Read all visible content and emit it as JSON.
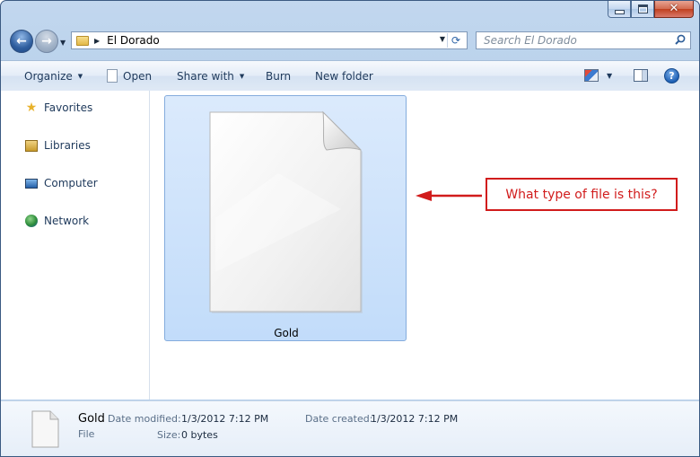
{
  "window": {
    "controls": {
      "minimize": "minimize",
      "maximize": "maximize",
      "close": "close"
    }
  },
  "address_bar": {
    "path": "El Dorado",
    "search_placeholder": "Search El Dorado"
  },
  "toolbar": {
    "organize": "Organize",
    "open": "Open",
    "share_with": "Share with",
    "burn": "Burn",
    "new_folder": "New folder",
    "help": "?"
  },
  "navigation": {
    "items": [
      {
        "label": "Favorites",
        "icon": "star-icon"
      },
      {
        "label": "Libraries",
        "icon": "libraries-icon"
      },
      {
        "label": "Computer",
        "icon": "computer-icon"
      },
      {
        "label": "Network",
        "icon": "network-icon"
      }
    ]
  },
  "files": [
    {
      "name": "Gold",
      "icon": "blank-document-icon",
      "selected": true
    }
  ],
  "annotation": {
    "text": "What type of file is this?",
    "color": "#d11c1c"
  },
  "details": {
    "name": "Gold",
    "type": "File",
    "date_modified_label": "Date modified:",
    "date_modified": "1/3/2012 7:12 PM",
    "date_created_label": "Date created:",
    "date_created": "1/3/2012 7:12 PM",
    "size_label": "Size:",
    "size": "0 bytes"
  },
  "colors": {
    "selection_fill": "#c2dcfa",
    "selection_border": "#84acdd",
    "frame": "#aecbe9"
  }
}
